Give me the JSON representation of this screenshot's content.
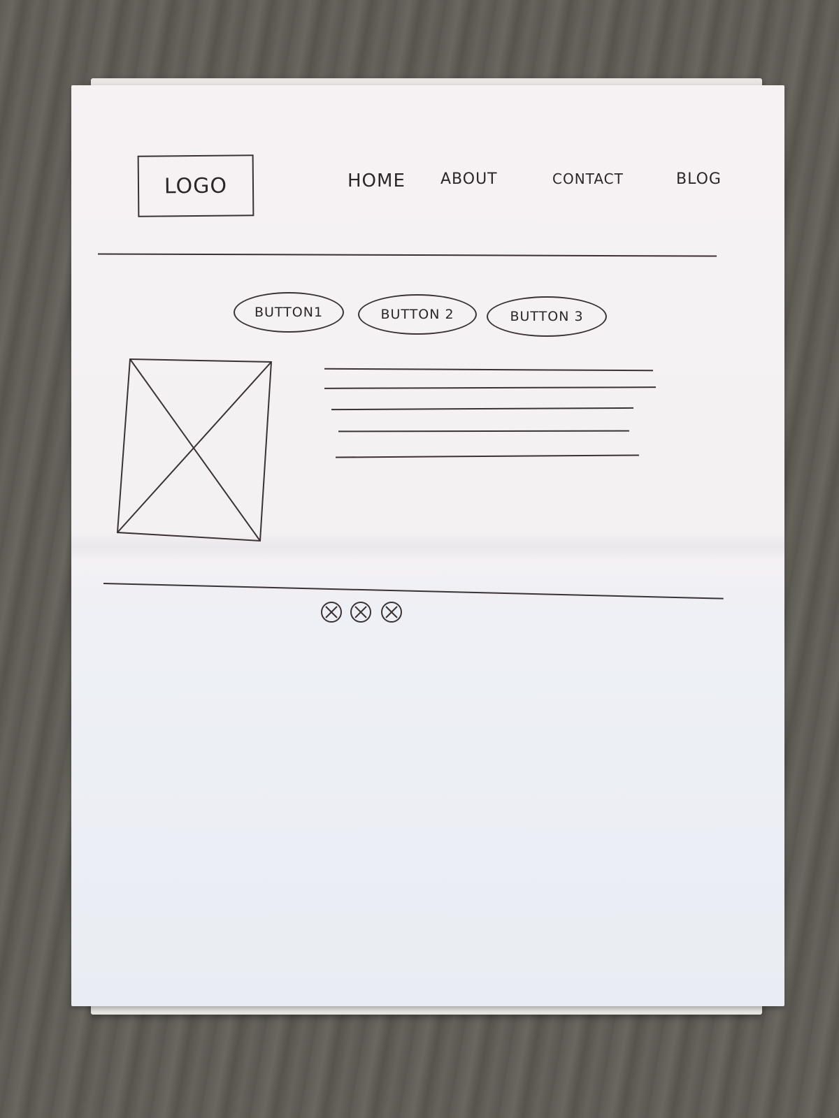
{
  "header": {
    "logo": "LOGO",
    "nav": [
      "HOME",
      "ABOUT",
      "CONTACT",
      "BLOG"
    ]
  },
  "actions": {
    "buttons": [
      "BUTTON1",
      "BUTTON 2",
      "BUTTON 3"
    ]
  },
  "content": {
    "image": "image-placeholder-icon",
    "text_lines": 5
  },
  "footer": {
    "social_icons": [
      "social-icon",
      "social-icon",
      "social-icon"
    ]
  },
  "colors": {
    "ink": "#2c2628",
    "paper": "#f4f1f3"
  }
}
